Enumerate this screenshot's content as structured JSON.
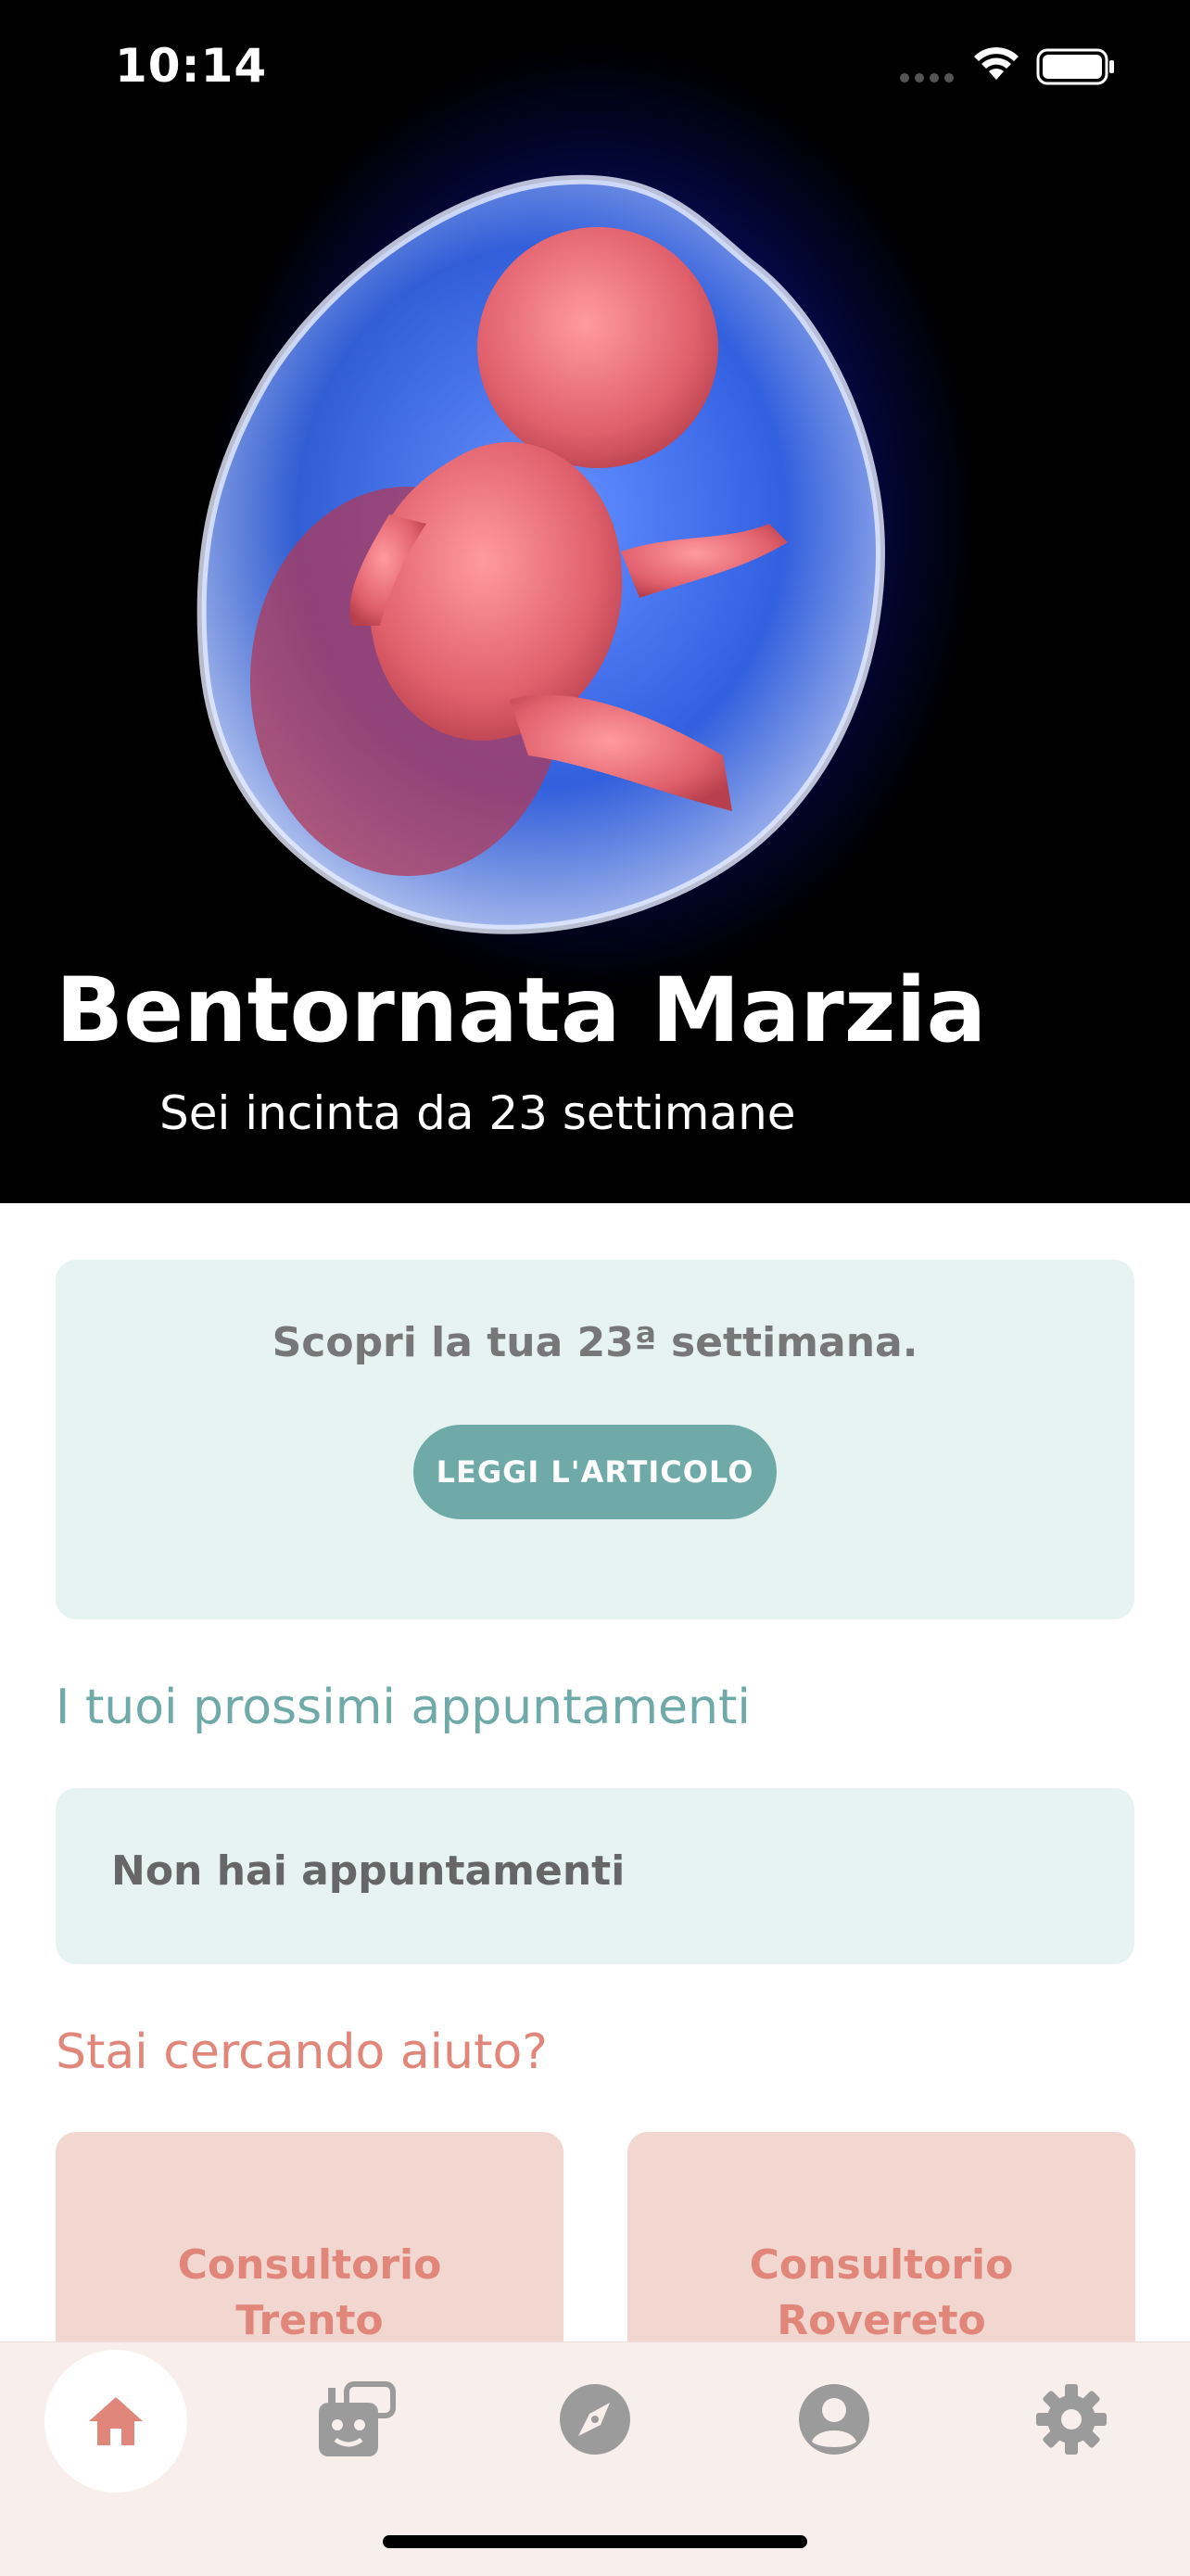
{
  "status_bar": {
    "time": "10:14"
  },
  "hero": {
    "title": "Bentornata Marzia",
    "subtitle": "Sei incinta da 23 settimane"
  },
  "week_card": {
    "text": "Scopri la tua 23ª settimana.",
    "button_label": "LEGGI L'ARTICOLO"
  },
  "appointments": {
    "heading": "I tuoi prossimi appuntamenti",
    "empty_text": "Non hai appuntamenti"
  },
  "help": {
    "heading": "Stai cercando aiuto?",
    "cards": [
      {
        "line1": "Consultorio",
        "line2": "Trento"
      },
      {
        "line1": "Consultorio",
        "line2": "Rovereto"
      }
    ]
  },
  "tab_bar": {
    "items": [
      {
        "icon": "home-icon",
        "active": true
      },
      {
        "icon": "chatbot-icon",
        "active": false
      },
      {
        "icon": "compass-icon",
        "active": false
      },
      {
        "icon": "profile-icon",
        "active": false
      },
      {
        "icon": "gear-icon",
        "active": false
      }
    ]
  },
  "colors": {
    "teal": "#6faaa8",
    "teal_light": "#e6f3f1",
    "coral": "#e0867a",
    "coral_light": "#f2d6d0",
    "tab_bg": "#f8eeeb",
    "icon_gray": "#9b9b9b"
  }
}
